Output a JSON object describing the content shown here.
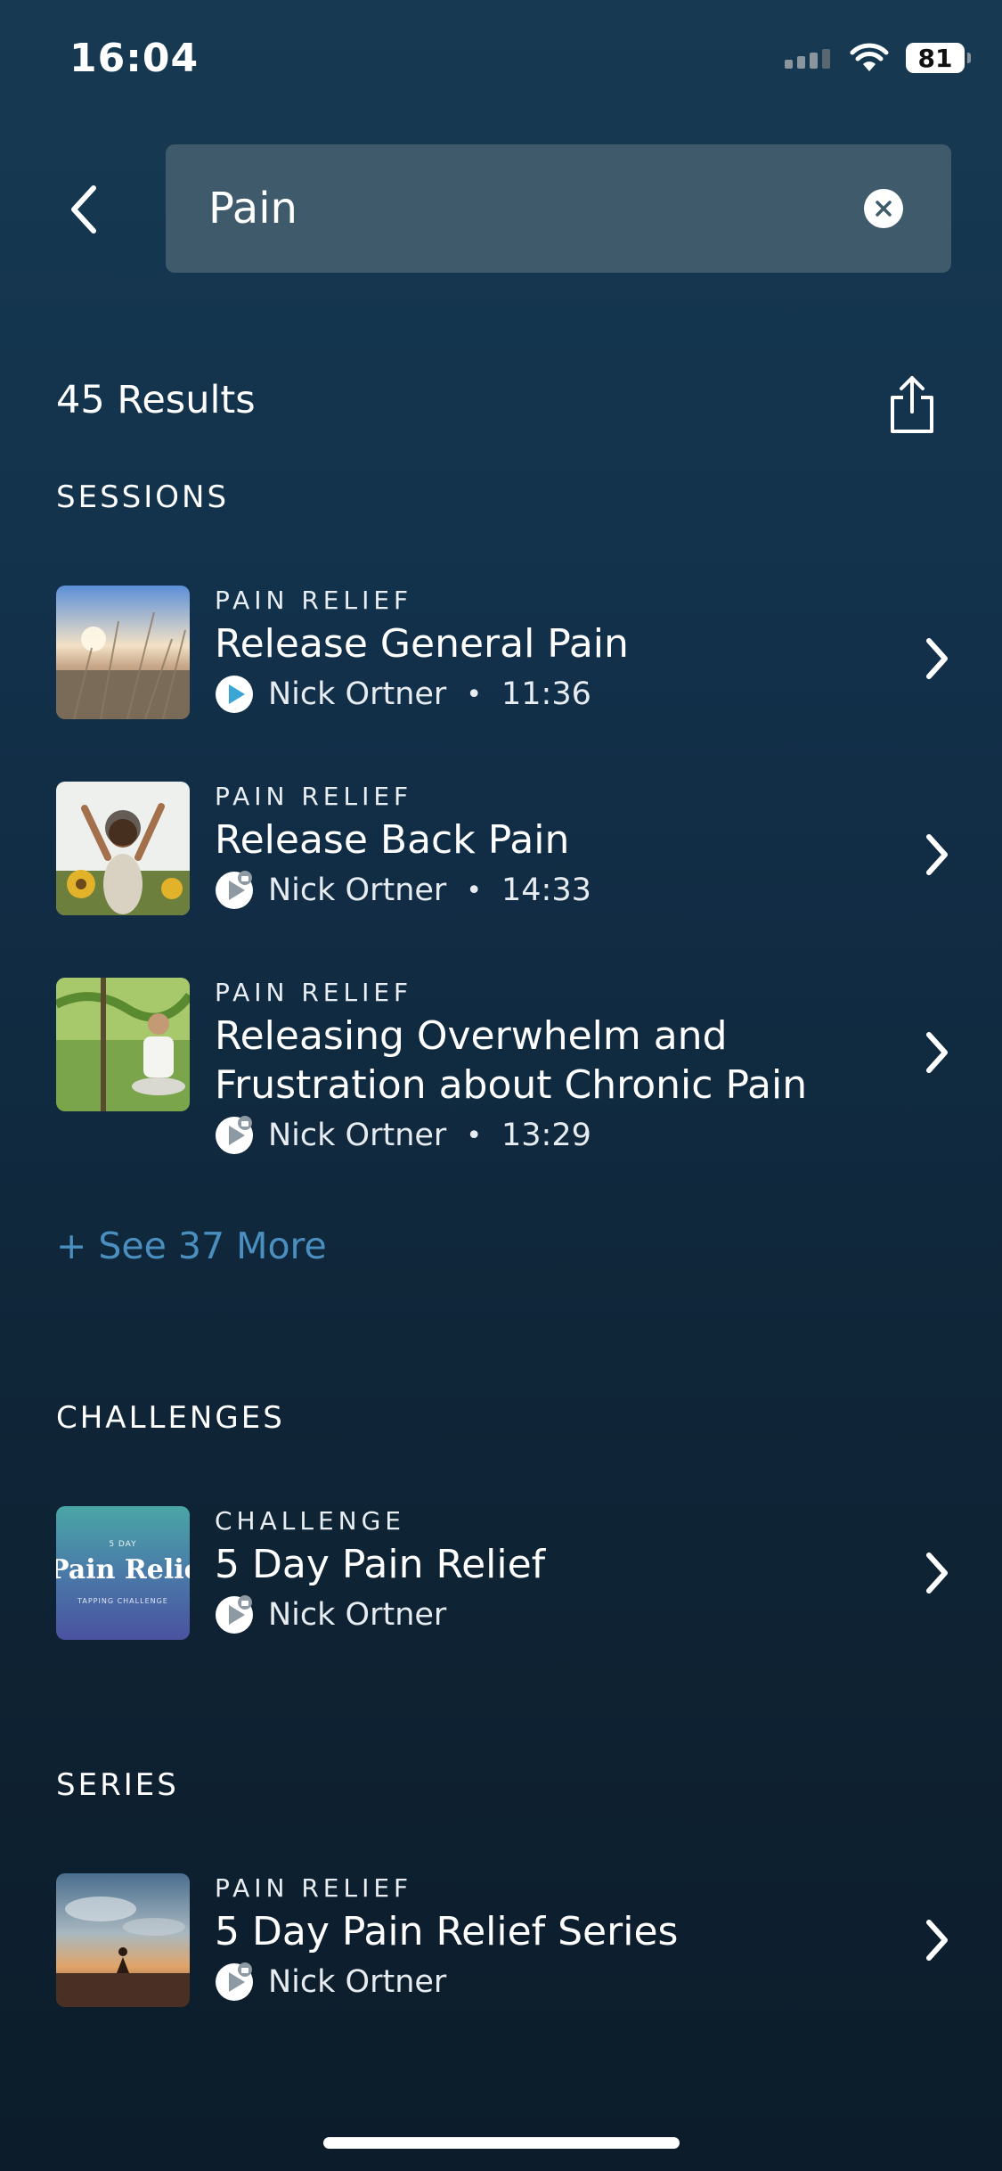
{
  "status_bar": {
    "time": "16:04",
    "battery": "81"
  },
  "search": {
    "value": "Pain",
    "placeholder": ""
  },
  "results": {
    "count_label": "45 Results"
  },
  "sections": {
    "sessions": {
      "title": "SESSIONS",
      "items": [
        {
          "category": "PAIN RELIEF",
          "title": "Release General Pain",
          "author": "Nick Ortner",
          "duration": "11:36",
          "locked": false
        },
        {
          "category": "PAIN RELIEF",
          "title": "Release Back Pain",
          "author": "Nick Ortner",
          "duration": "14:33",
          "locked": true
        },
        {
          "category": "PAIN RELIEF",
          "title": "Releasing Overwhelm and Frustration about Chronic Pain",
          "author": "Nick Ortner",
          "duration": "13:29",
          "locked": true
        }
      ],
      "see_more": "+ See 37 More"
    },
    "challenges": {
      "title": "CHALLENGES",
      "items": [
        {
          "category": "CHALLENGE",
          "title": "5 Day Pain Relief",
          "author": "Nick Ortner",
          "locked": true,
          "thumb_small": "5 DAY",
          "thumb_big": "Pain Relief",
          "thumb_caption": "TAPPING CHALLENGE"
        }
      ]
    },
    "series": {
      "title": "SERIES",
      "items": [
        {
          "category": "PAIN RELIEF",
          "title": "5 Day Pain Relief Series",
          "author": "Nick Ortner",
          "locked": true
        }
      ]
    }
  },
  "colors": {
    "background_top": "#173a52",
    "background_bottom": "#0c1c2a",
    "search_field": "#3f5a6a",
    "link": "#4a8fbf",
    "play_accent": "#3aa6d6"
  },
  "icons": {
    "back": "chevron-left-icon",
    "clear": "clear-x-icon",
    "share": "share-icon",
    "play": "play-icon",
    "lock": "lock-icon",
    "row_chevron": "chevron-right-icon",
    "signal": "signal-icon",
    "wifi": "wifi-icon"
  }
}
